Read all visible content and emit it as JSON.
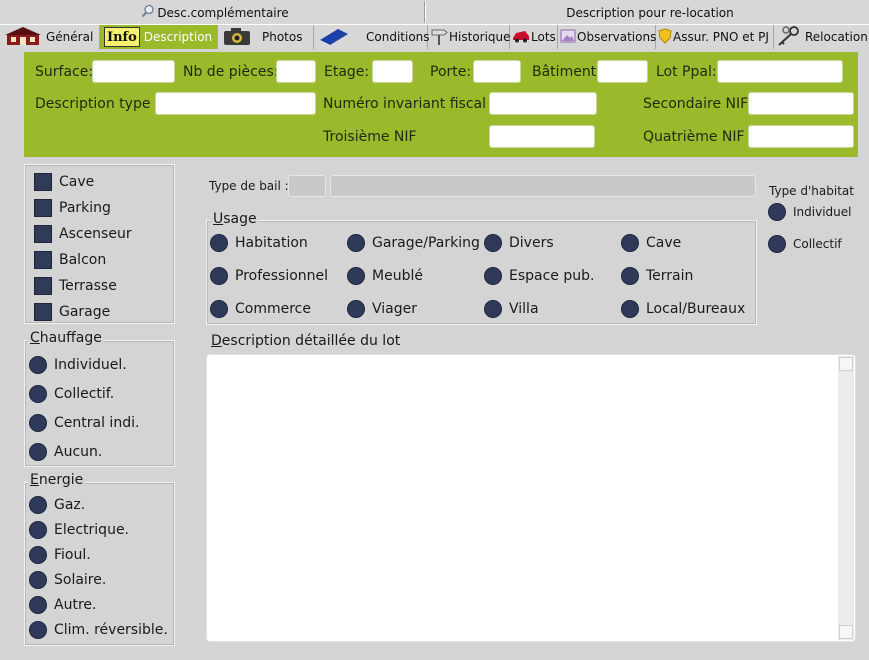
{
  "top_tabs": {
    "desc_comp": "Desc.complémentaire",
    "relocation_desc": "Description pour re-location"
  },
  "tabs": [
    {
      "label": "Général",
      "icon": "house-icon"
    },
    {
      "label": "Description",
      "icon": "info-icon"
    },
    {
      "label": "Photos",
      "icon": "camera-icon"
    },
    {
      "label": "Conditions",
      "icon": "book-icon"
    },
    {
      "label": "Historique",
      "icon": "signpost-icon"
    },
    {
      "label": "Lots",
      "icon": "car-icon"
    },
    {
      "label": "Observations",
      "icon": "photo-icon"
    },
    {
      "label": "Assur. PNO et PJ",
      "icon": "shield-icon"
    },
    {
      "label": "Relocation",
      "icon": "keys-icon"
    }
  ],
  "info_icon_text": "Info",
  "form": {
    "surface": "Surface:",
    "nb_pieces": "Nb de pièces:",
    "etage": "Etage:",
    "porte": "Porte:",
    "batiment": "Bâtiment:",
    "lot_ppal": "Lot Ppal:",
    "description_type": "Description type :",
    "numero_invariant": "Numéro invariant fiscal :",
    "secondaire_nif": "Secondaire NIF",
    "troisieme_nif": "Troisième NIF",
    "quatrieme_nif": "Quatrième NIF"
  },
  "equipements": [
    "Cave",
    "Parking",
    "Ascenseur",
    "Balcon",
    "Terrasse",
    "Garage"
  ],
  "chauffage": {
    "title_underlined": "C",
    "title_rest": "hauffage",
    "options": [
      "Individuel.",
      "Collectif.",
      "Central indi.",
      "Aucun."
    ]
  },
  "energie": {
    "title_underlined": "E",
    "title_rest": "nergie",
    "options": [
      "Gaz.",
      "Electrique.",
      "Fioul.",
      "Solaire.",
      "Autre.",
      "Clim. réversible."
    ]
  },
  "type_bail": {
    "label": "Type de bail :",
    "code": "",
    "value": ""
  },
  "usage": {
    "title_underlined": "U",
    "title_rest": "sage",
    "options": [
      "Habitation",
      "Garage/Parking",
      "Divers",
      "Cave",
      "Professionnel",
      "Meublé",
      "Espace pub.",
      "Terrain",
      "Commerce",
      "Viager",
      "Villa",
      "Local/Bureaux"
    ]
  },
  "type_habitat": {
    "title": "Type d'habitat",
    "options": [
      "Individuel",
      "Collectif"
    ]
  },
  "description_detaillee": {
    "title_underlined": "D",
    "title_rest": "escription détaillée du lot",
    "value": ""
  },
  "colors": {
    "accent_green": "#9aba2c",
    "radio_fill": "#2f3a5a",
    "background": "#d4d4d4"
  }
}
